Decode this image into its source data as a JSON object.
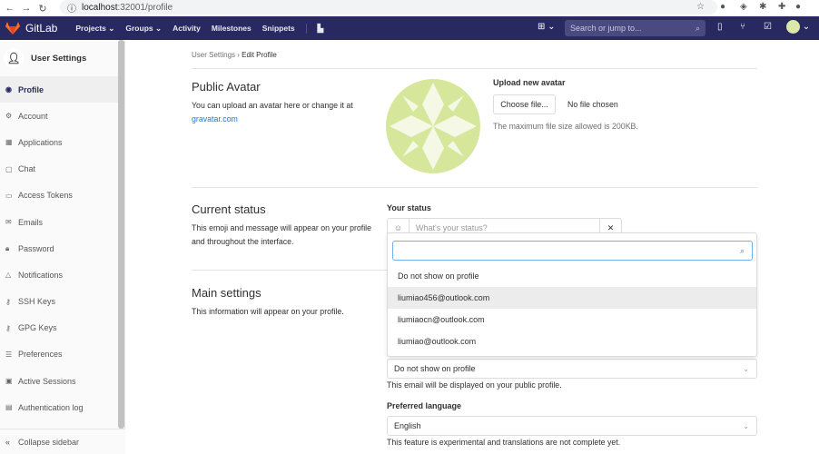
{
  "browser": {
    "url_host": "localhost",
    "url_rest": ":32001/profile"
  },
  "navbar": {
    "brand": "GitLab",
    "links": [
      "Projects ⌄",
      "Groups ⌄",
      "Activity",
      "Milestones",
      "Snippets"
    ],
    "search_placeholder": "Search or jump to...",
    "bg": "#292961"
  },
  "sidebar": {
    "title": "User Settings",
    "items": [
      {
        "label": "Profile",
        "icon": "◉"
      },
      {
        "label": "Account",
        "icon": "⚙"
      },
      {
        "label": "Applications",
        "icon": "▦"
      },
      {
        "label": "Chat",
        "icon": "▢"
      },
      {
        "label": "Access Tokens",
        "icon": "▭"
      },
      {
        "label": "Emails",
        "icon": "✉"
      },
      {
        "label": "Password",
        "icon": "🔒︎"
      },
      {
        "label": "Notifications",
        "icon": "△"
      },
      {
        "label": "SSH Keys",
        "icon": "⚷"
      },
      {
        "label": "GPG Keys",
        "icon": "⚷"
      },
      {
        "label": "Preferences",
        "icon": "☰"
      },
      {
        "label": "Active Sessions",
        "icon": "▣"
      },
      {
        "label": "Authentication log",
        "icon": "▤"
      }
    ],
    "collapse": "Collapse sidebar"
  },
  "breadcrumb": {
    "parent": "User Settings",
    "current": "Edit Profile"
  },
  "avatar": {
    "title": "Public Avatar",
    "desc": "You can upload an avatar here or change it at",
    "link": "gravatar.com",
    "upload_label": "Upload new avatar",
    "choose": "Choose file...",
    "no_file": "No file chosen",
    "max": "The maximum file size allowed is 200KB."
  },
  "status": {
    "title": "Current status",
    "desc": "This emoji and message will appear on your profile and throughout the interface.",
    "label": "Your status",
    "placeholder": "What's your status?"
  },
  "main_settings": {
    "title": "Main settings",
    "desc": "This information will appear on your profile."
  },
  "email_dropdown": {
    "options": [
      "Do not show on profile",
      "liumiao456@outlook.com",
      "liumiaocn@outlook.com",
      "liumiao@outlook.com"
    ],
    "selected": "Do not show on profile",
    "note": "This email will be displayed on your public profile."
  },
  "language": {
    "label": "Preferred language",
    "selected": "English",
    "note": "This feature is experimental and translations are not complete yet."
  }
}
